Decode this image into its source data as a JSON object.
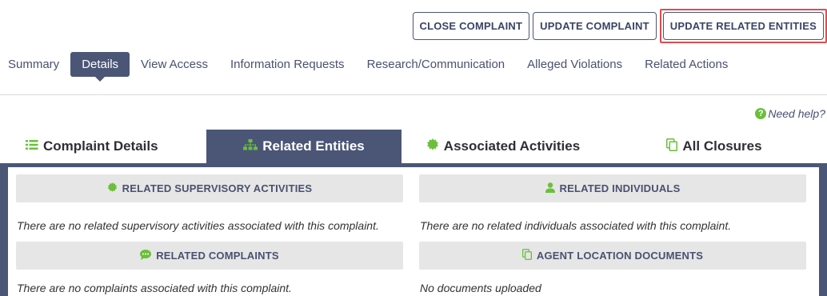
{
  "header": {
    "close_label": "CLOSE COMPLAINT",
    "update_label": "UPDATE COMPLAINT",
    "update_related_label": "UPDATE RELATED ENTITIES"
  },
  "tabs": [
    {
      "label": "Summary"
    },
    {
      "label": "Details"
    },
    {
      "label": "View Access"
    },
    {
      "label": "Information Requests"
    },
    {
      "label": "Research/Communication"
    },
    {
      "label": "Alleged Violations"
    },
    {
      "label": "Related Actions"
    }
  ],
  "help": {
    "icon": "?",
    "label": "Need help?"
  },
  "subtabs": [
    {
      "label": "Complaint Details",
      "icon": "list-icon"
    },
    {
      "label": "Related Entities",
      "icon": "sitemap-icon"
    },
    {
      "label": "Associated Activities",
      "icon": "certificate-icon"
    },
    {
      "label": "All Closures",
      "icon": "copy-icon"
    }
  ],
  "sections": {
    "supervisory": {
      "title": "RELATED SUPERVISORY ACTIVITIES",
      "text": "There are no related supervisory activities associated with this complaint."
    },
    "individuals": {
      "title": "RELATED INDIVIDUALS",
      "text": "There are no related individuals associated with this complaint."
    },
    "complaints": {
      "title": "RELATED COMPLAINTS",
      "text": "There are no complaints associated with this complaint."
    },
    "documents": {
      "title": "AGENT LOCATION DOCUMENTS",
      "text": "No documents uploaded"
    }
  },
  "colors": {
    "accent": "#4b5677",
    "icon_green": "#6abf3b",
    "highlight": "#e04b52"
  }
}
